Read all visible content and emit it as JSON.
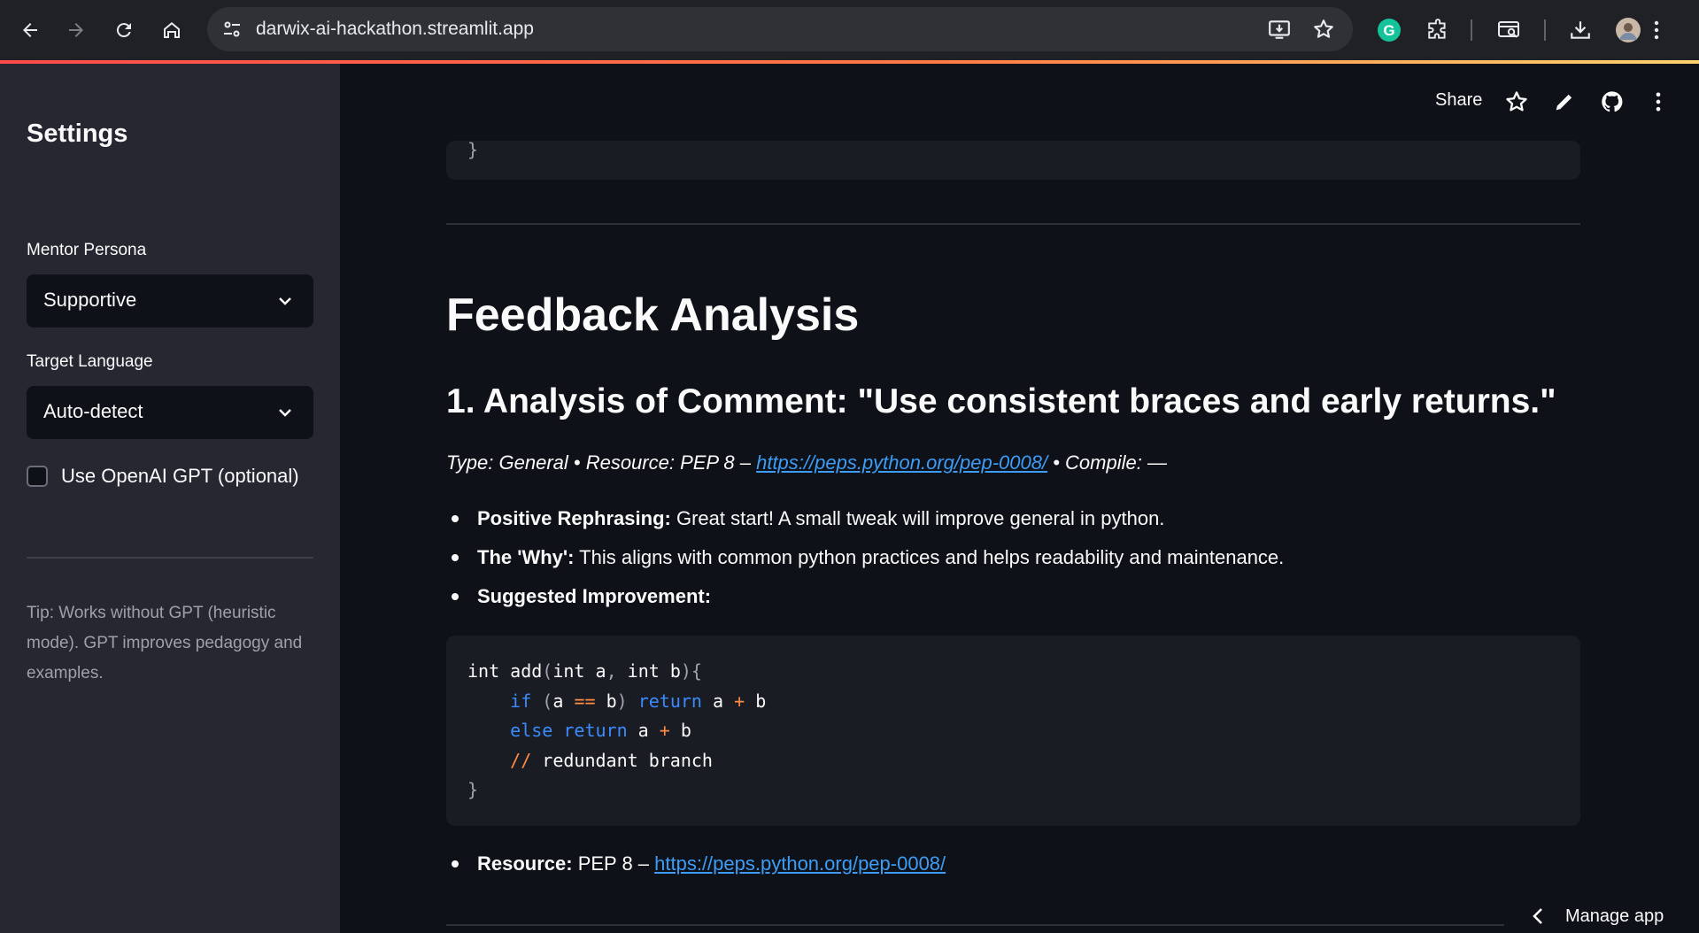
{
  "browser": {
    "url": "darwix-ai-hackathon.streamlit.app"
  },
  "header": {
    "share_label": "Share"
  },
  "sidebar": {
    "title": "Settings",
    "persona_label": "Mentor Persona",
    "persona_value": "Supportive",
    "language_label": "Target Language",
    "language_value": "Auto-detect",
    "gpt_checkbox_label": "Use OpenAI GPT (optional)",
    "gpt_checked": false,
    "tip": "Tip: Works without GPT (heuristic mode). GPT improves pedagogy and examples."
  },
  "main": {
    "top_code_tail": "}",
    "heading": "Feedback Analysis",
    "subheading": "1. Analysis of Comment: \"Use consistent braces and early returns.\"",
    "meta_prefix": "Type: General • Resource: PEP 8 – ",
    "meta_link": "https://peps.python.org/pep-0008/",
    "meta_suffix": " • Compile: —",
    "bullets": [
      {
        "label": "Positive Rephrasing:",
        "text": " Great start! A small tweak will improve general in python."
      },
      {
        "label": "The 'Why':",
        "text": " This aligns with common python practices and helps readability and maintenance."
      },
      {
        "label": "Suggested Improvement:",
        "text": ""
      }
    ],
    "code": {
      "line1_a": "int add",
      "line1_b": "(",
      "line1_c": "int a",
      "line1_d": ", ",
      "line1_e": "int b",
      "line1_f": "){",
      "line2_indent": "    ",
      "line2_if": "if",
      "line2_sp": " (",
      "line2_a": "a ",
      "line2_eq": "==",
      "line2_b": " b",
      "line2_close": ")",
      "line2_ret": " return",
      "line2_a2": " a ",
      "line2_plus": "+",
      "line2_b2": " b",
      "line3_indent": "    ",
      "line3_else": "else",
      "line3_ret": " return",
      "line3_a": " a ",
      "line3_plus": "+",
      "line3_b": " b",
      "line4_indent": "    ",
      "line4_comment_mark": "//",
      "line4_comment_text": " redundant branch",
      "line5": "}"
    },
    "resource_label": "Resource:",
    "resource_text": " PEP 8 – ",
    "resource_link": "https://peps.python.org/pep-0008/"
  },
  "footer": {
    "manage_label": "Manage app"
  }
}
